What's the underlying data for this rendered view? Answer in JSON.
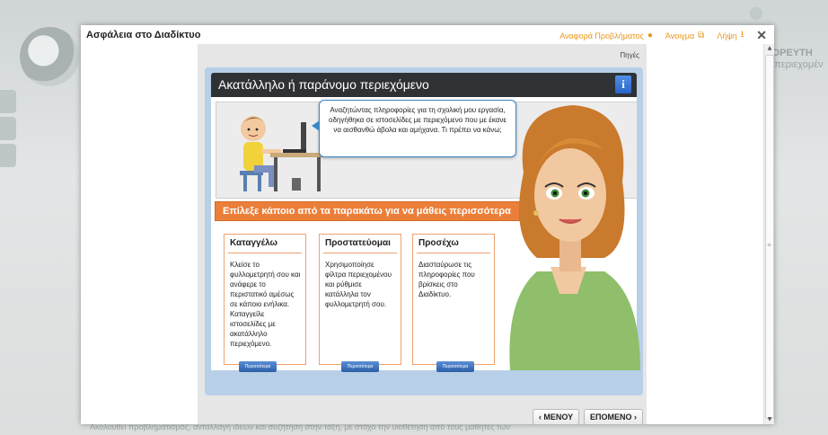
{
  "background": {
    "side_title_line1": "ΣΟΡΕΥΤΗ",
    "side_title_line2": "ή περιεχομέν",
    "footer_text": "Ακολουθεί προβληματισμός, ανταλλαγή ιδεών και συζήτηση στην τάξη, με στόχο την υιοθέτηση από τους μαθητές των"
  },
  "modal": {
    "title": "Ασφάλεια στο Διαδίκτυο",
    "report_label": "Αναφορά Προβλήματος",
    "open_label": "Άνοιγμα",
    "download_label": "Λήψη",
    "close_symbol": "✕"
  },
  "panel": {
    "sources_label": "Πηγές",
    "lesson_title": "Ακατάλληλο ή παράνομο περιεχόμενο",
    "info_label": "i",
    "bubble_text": "Αναζητώντας πληροφορίες για τη σχολική μου εργασία, οδηγήθηκα σε ιστοσελίδες με περιεχόμενο που με έκανε να αισθανθώ άβολα και αμήχανα. Τι πρέπει να κάνω;",
    "banner_text": "Επίλεξε κάποιο από τα παρακάτω για να μάθεις περισσότερα",
    "cards": [
      {
        "title": "Καταγγέλω",
        "text": "Κλείσε το φυλλομετρητή σου και ανάφερε το περιστατικό αμέσως σε κάποιο ενήλικα. Καταγγείλε ιστοσελίδες με ακατάλληλο περιεχόμενο.",
        "more": "Περισσότερα"
      },
      {
        "title": "Προστατεύομαι",
        "text": "Χρησιμοποίησε φίλτρα περιεχομένου και ρύθμισε κατάλληλα τον φυλλομετρητή σου.",
        "more": "Περισσότερα"
      },
      {
        "title": "Προσέχω",
        "text": "Διασταύρωσε τις πληροφορίες που βρίσκεις στο Διαδίκτυο.",
        "more": "Περισσότερα"
      }
    ]
  },
  "nav": {
    "menu_label": "‹ ΜΕΝΟΥ",
    "next_label": "ΕΠΟΜΕΝΟ ›"
  },
  "colors": {
    "accent_orange": "#eb7f3a",
    "header_dark": "#2f3234",
    "info_blue": "#2a64c6",
    "action_orange": "#e8961c"
  }
}
